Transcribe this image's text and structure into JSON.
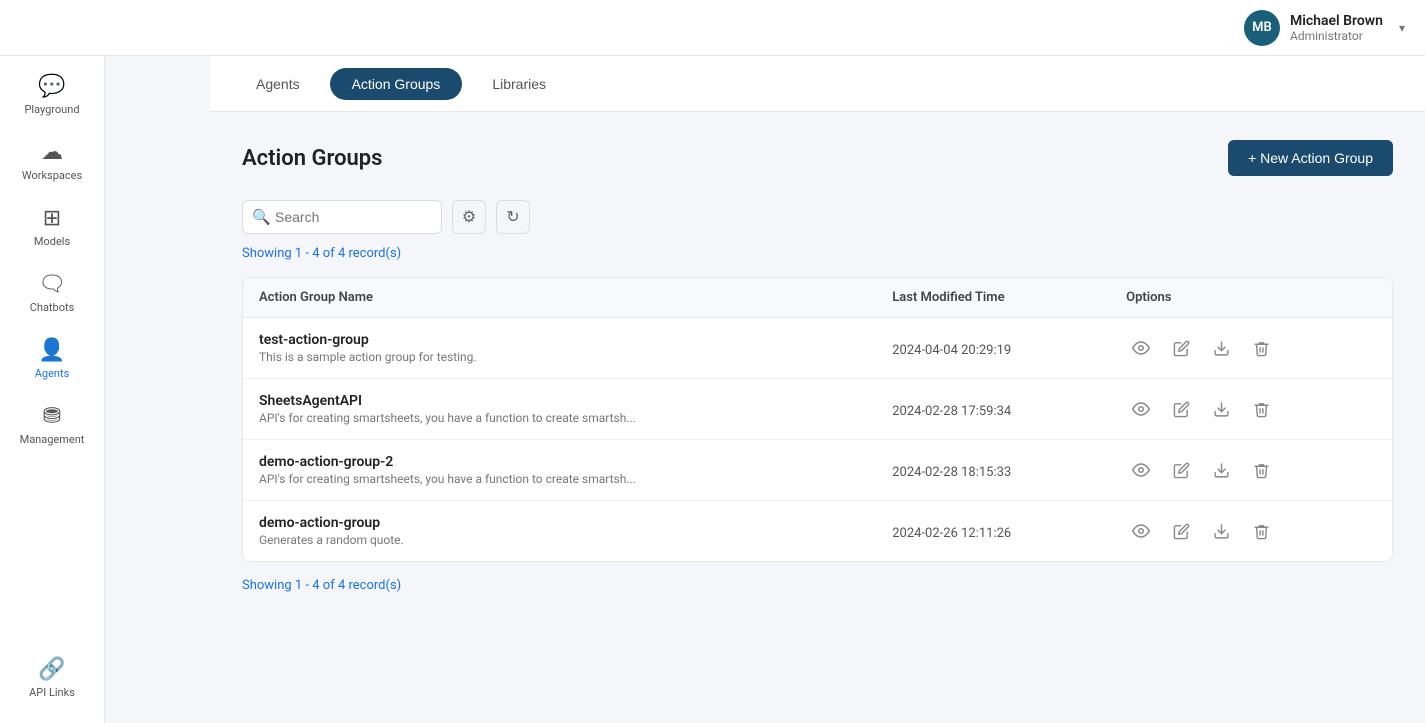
{
  "topbar": {
    "user_name": "Michael Brown",
    "user_role": "Administrator",
    "user_initials": "MB",
    "chevron": "▾"
  },
  "sidebar": {
    "logo_alt": "AI Logo",
    "items": [
      {
        "id": "playground",
        "label": "Playground",
        "icon": "💬"
      },
      {
        "id": "workspaces",
        "label": "Workspaces",
        "icon": "☁"
      },
      {
        "id": "models",
        "label": "Models",
        "icon": "⊞"
      },
      {
        "id": "chatbots",
        "label": "Chatbots",
        "icon": "🗨"
      },
      {
        "id": "agents",
        "label": "Agents",
        "icon": "👤"
      },
      {
        "id": "management",
        "label": "Management",
        "icon": "⛃"
      }
    ],
    "bottom_items": [
      {
        "id": "api-links",
        "label": "API Links",
        "icon": "🔗"
      }
    ]
  },
  "tabs": [
    {
      "id": "agents",
      "label": "Agents",
      "active": false
    },
    {
      "id": "action-groups",
      "label": "Action Groups",
      "active": true
    },
    {
      "id": "libraries",
      "label": "Libraries",
      "active": false
    }
  ],
  "page": {
    "title": "Action Groups",
    "new_button_label": "+ New Action Group"
  },
  "search": {
    "placeholder": "Search"
  },
  "records": {
    "top_count": "Showing 1 - 4 of 4 record(s)",
    "bottom_count": "Showing 1 - 4 of 4 record(s)"
  },
  "table": {
    "columns": [
      {
        "id": "name",
        "label": "Action Group Name"
      },
      {
        "id": "modified",
        "label": "Last Modified Time"
      },
      {
        "id": "options",
        "label": "Options"
      }
    ],
    "rows": [
      {
        "id": 1,
        "name": "test-action-group",
        "description": "This is a sample action group for testing.",
        "modified": "2024-04-04 20:29:19"
      },
      {
        "id": 2,
        "name": "SheetsAgentAPI",
        "description": "API's for creating smartsheets, you have a function to create smartsh...",
        "modified": "2024-02-28 17:59:34"
      },
      {
        "id": 3,
        "name": "demo-action-group-2",
        "description": "API's for creating smartsheets, you have a function to create smartsh...",
        "modified": "2024-02-28 18:15:33"
      },
      {
        "id": 4,
        "name": "demo-action-group",
        "description": "Generates a random quote.",
        "modified": "2024-02-26 12:11:26"
      }
    ]
  },
  "icons": {
    "view": "👁",
    "edit": "✏",
    "download": "⬇",
    "delete": "🗑",
    "search": "🔍",
    "filter": "⚙",
    "refresh": "↻"
  }
}
